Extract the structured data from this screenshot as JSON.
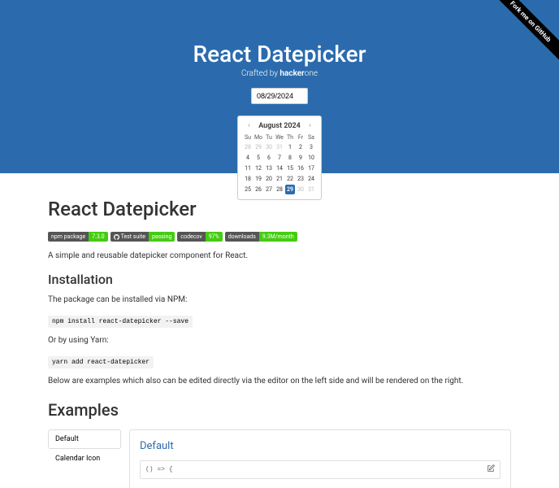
{
  "ribbon": "Fork me on GitHub",
  "hero": {
    "title": "React Datepicker",
    "crafted_prefix": "Crafted by ",
    "crafted_brand": "hacker",
    "crafted_suffix": "one"
  },
  "input_value": "08/29/2024",
  "calendar": {
    "month_label": "August 2024",
    "dow": [
      "Su",
      "Mo",
      "Tu",
      "We",
      "Th",
      "Fr",
      "Sa"
    ],
    "days": [
      {
        "n": 28,
        "out": true
      },
      {
        "n": 29,
        "out": true
      },
      {
        "n": 30,
        "out": true
      },
      {
        "n": 31,
        "out": true
      },
      {
        "n": 1
      },
      {
        "n": 2
      },
      {
        "n": 3
      },
      {
        "n": 4
      },
      {
        "n": 5
      },
      {
        "n": 6
      },
      {
        "n": 7
      },
      {
        "n": 8
      },
      {
        "n": 9
      },
      {
        "n": 10
      },
      {
        "n": 11
      },
      {
        "n": 12
      },
      {
        "n": 13
      },
      {
        "n": 14
      },
      {
        "n": 15
      },
      {
        "n": 16
      },
      {
        "n": 17
      },
      {
        "n": 18
      },
      {
        "n": 19
      },
      {
        "n": 20
      },
      {
        "n": 21
      },
      {
        "n": 22
      },
      {
        "n": 23
      },
      {
        "n": 24
      },
      {
        "n": 25
      },
      {
        "n": 26
      },
      {
        "n": 27
      },
      {
        "n": 28
      },
      {
        "n": 29,
        "sel": true
      },
      {
        "n": 30,
        "out": true
      },
      {
        "n": 31,
        "out": true
      }
    ]
  },
  "page_title": "React Datepicker",
  "badges": [
    {
      "left": "npm package",
      "right": "7.3.0",
      "color": "#4c1"
    },
    {
      "left": "Test suite",
      "right": "passing",
      "color": "#4c1",
      "gh": true
    },
    {
      "left": "codecov",
      "right": "97%",
      "color": "#4c1"
    },
    {
      "left": "downloads",
      "right": "9.3M/month",
      "color": "#4c1"
    }
  ],
  "description": "A simple and reusable datepicker component for React.",
  "install_title": "Installation",
  "install_text1": "The package can be installed via NPM:",
  "install_cmd1": "npm install react-datepicker --save",
  "install_text2": "Or by using Yarn:",
  "install_cmd2": "yarn add react-datepicker",
  "install_text3": "Below are examples which also can be edited directly via the editor on the left side and will be rendered on the right.",
  "examples_title": "Examples",
  "ex_nav": [
    "Default",
    "Calendar Icon"
  ],
  "ex_active": 0,
  "example": {
    "title": "Default",
    "code": "() => {"
  }
}
